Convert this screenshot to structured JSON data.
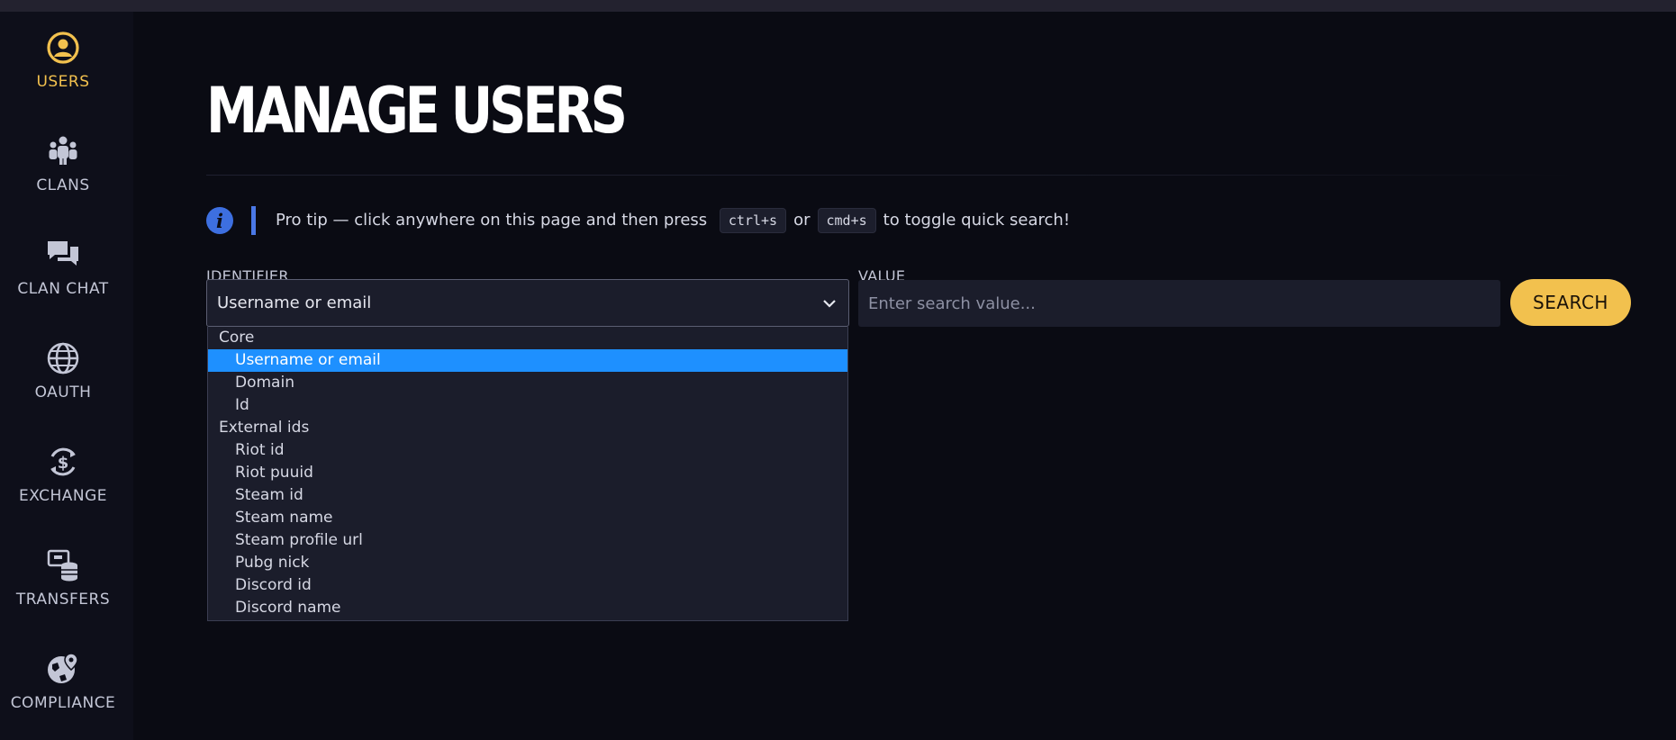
{
  "sidebar": {
    "items": [
      {
        "label": "USERS",
        "icon": "user-circle-icon",
        "active": true
      },
      {
        "label": "CLANS",
        "icon": "group-icon"
      },
      {
        "label": "CLAN CHAT",
        "icon": "chat-icon"
      },
      {
        "label": "OAUTH",
        "icon": "globe-icon"
      },
      {
        "label": "EXCHANGE",
        "icon": "currency-exchange-icon"
      },
      {
        "label": "TRANSFERS",
        "icon": "database-transfer-icon"
      },
      {
        "label": "COMPLIANCE",
        "icon": "globe-location-icon"
      }
    ]
  },
  "page": {
    "title": "MANAGE USERS"
  },
  "tip": {
    "prefix": "Pro tip — click anywhere on this page and then press",
    "key1": "ctrl+s",
    "or": "or",
    "key2": "cmd+s",
    "suffix": "to toggle quick search!"
  },
  "form": {
    "identifier_label": "IDENTIFIER",
    "identifier_value": "Username or email",
    "value_label": "VALUE",
    "value_placeholder": "Enter search value...",
    "search_label": "SEARCH"
  },
  "dropdown": {
    "groups": [
      {
        "label": "Core",
        "options": [
          "Username or email",
          "Domain",
          "Id"
        ]
      },
      {
        "label": "External ids",
        "options": [
          "Riot id",
          "Riot puuid",
          "Steam id",
          "Steam name",
          "Steam profile url",
          "Pubg nick",
          "Discord id",
          "Discord name"
        ]
      }
    ],
    "selected": "Username or email"
  },
  "colors": {
    "accent": "#f2c14e",
    "info": "#3d6fe0",
    "selected_option": "#1e90ff",
    "background": "#0a0b13"
  }
}
